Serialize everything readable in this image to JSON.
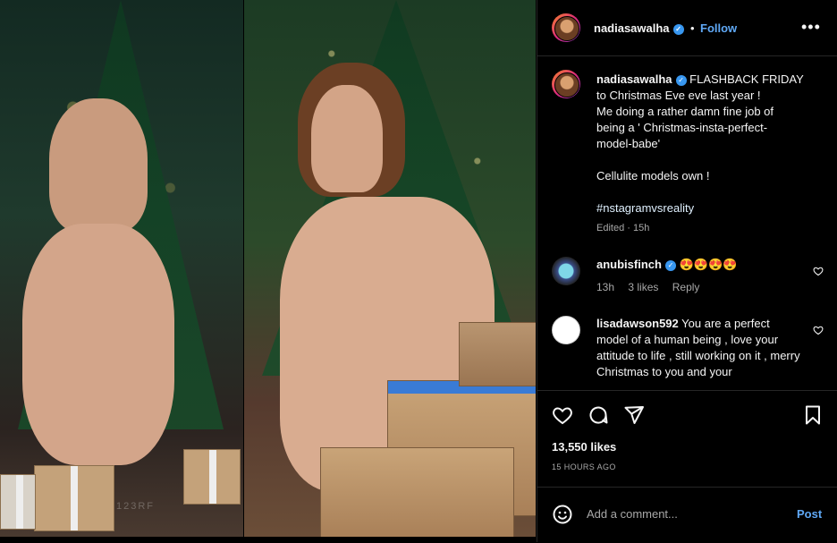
{
  "post": {
    "username": "nadiasawalha",
    "verified": true,
    "separator": "•",
    "follow_label": "Follow",
    "more_label": "•••",
    "photo_watermark": "123RF"
  },
  "caption": {
    "username": "nadiasawalha",
    "lines": [
      "FLASHBACK FRIDAY",
      "to Christmas Eve eve last year !",
      "Me doing a rather damn fine job of",
      "being a ' Christmas-insta-perfect-",
      "model-babe'",
      "",
      "Cellulite models own !",
      "",
      "#nstagramvsreality"
    ],
    "edited": "Edited · 15h"
  },
  "comments": [
    {
      "username": "anubisfinch",
      "text": "😍😍😍😍",
      "time": "13h",
      "likes": "3 likes",
      "reply": "Reply",
      "verified": true
    },
    {
      "username": "lisadawson592",
      "text": "You are a perfect model of a human being , love your attitude to life , still working on it , merry Christmas to you and your",
      "time": "",
      "likes": "",
      "reply": "",
      "verified": false
    }
  ],
  "actions": {
    "like_icon": "heart-icon",
    "comment_icon": "comment-icon",
    "share_icon": "send-icon",
    "save_icon": "bookmark-icon"
  },
  "likes_text": "13,550 likes",
  "timestamp": "15 HOURS AGO",
  "add_comment": {
    "placeholder": "Add a comment...",
    "post_label": "Post",
    "emoji_icon": "emoji-icon"
  },
  "colors": {
    "background": "#000000",
    "link": "#5fa8f5",
    "verified": "#3897f0",
    "muted": "#a8a8a8"
  }
}
